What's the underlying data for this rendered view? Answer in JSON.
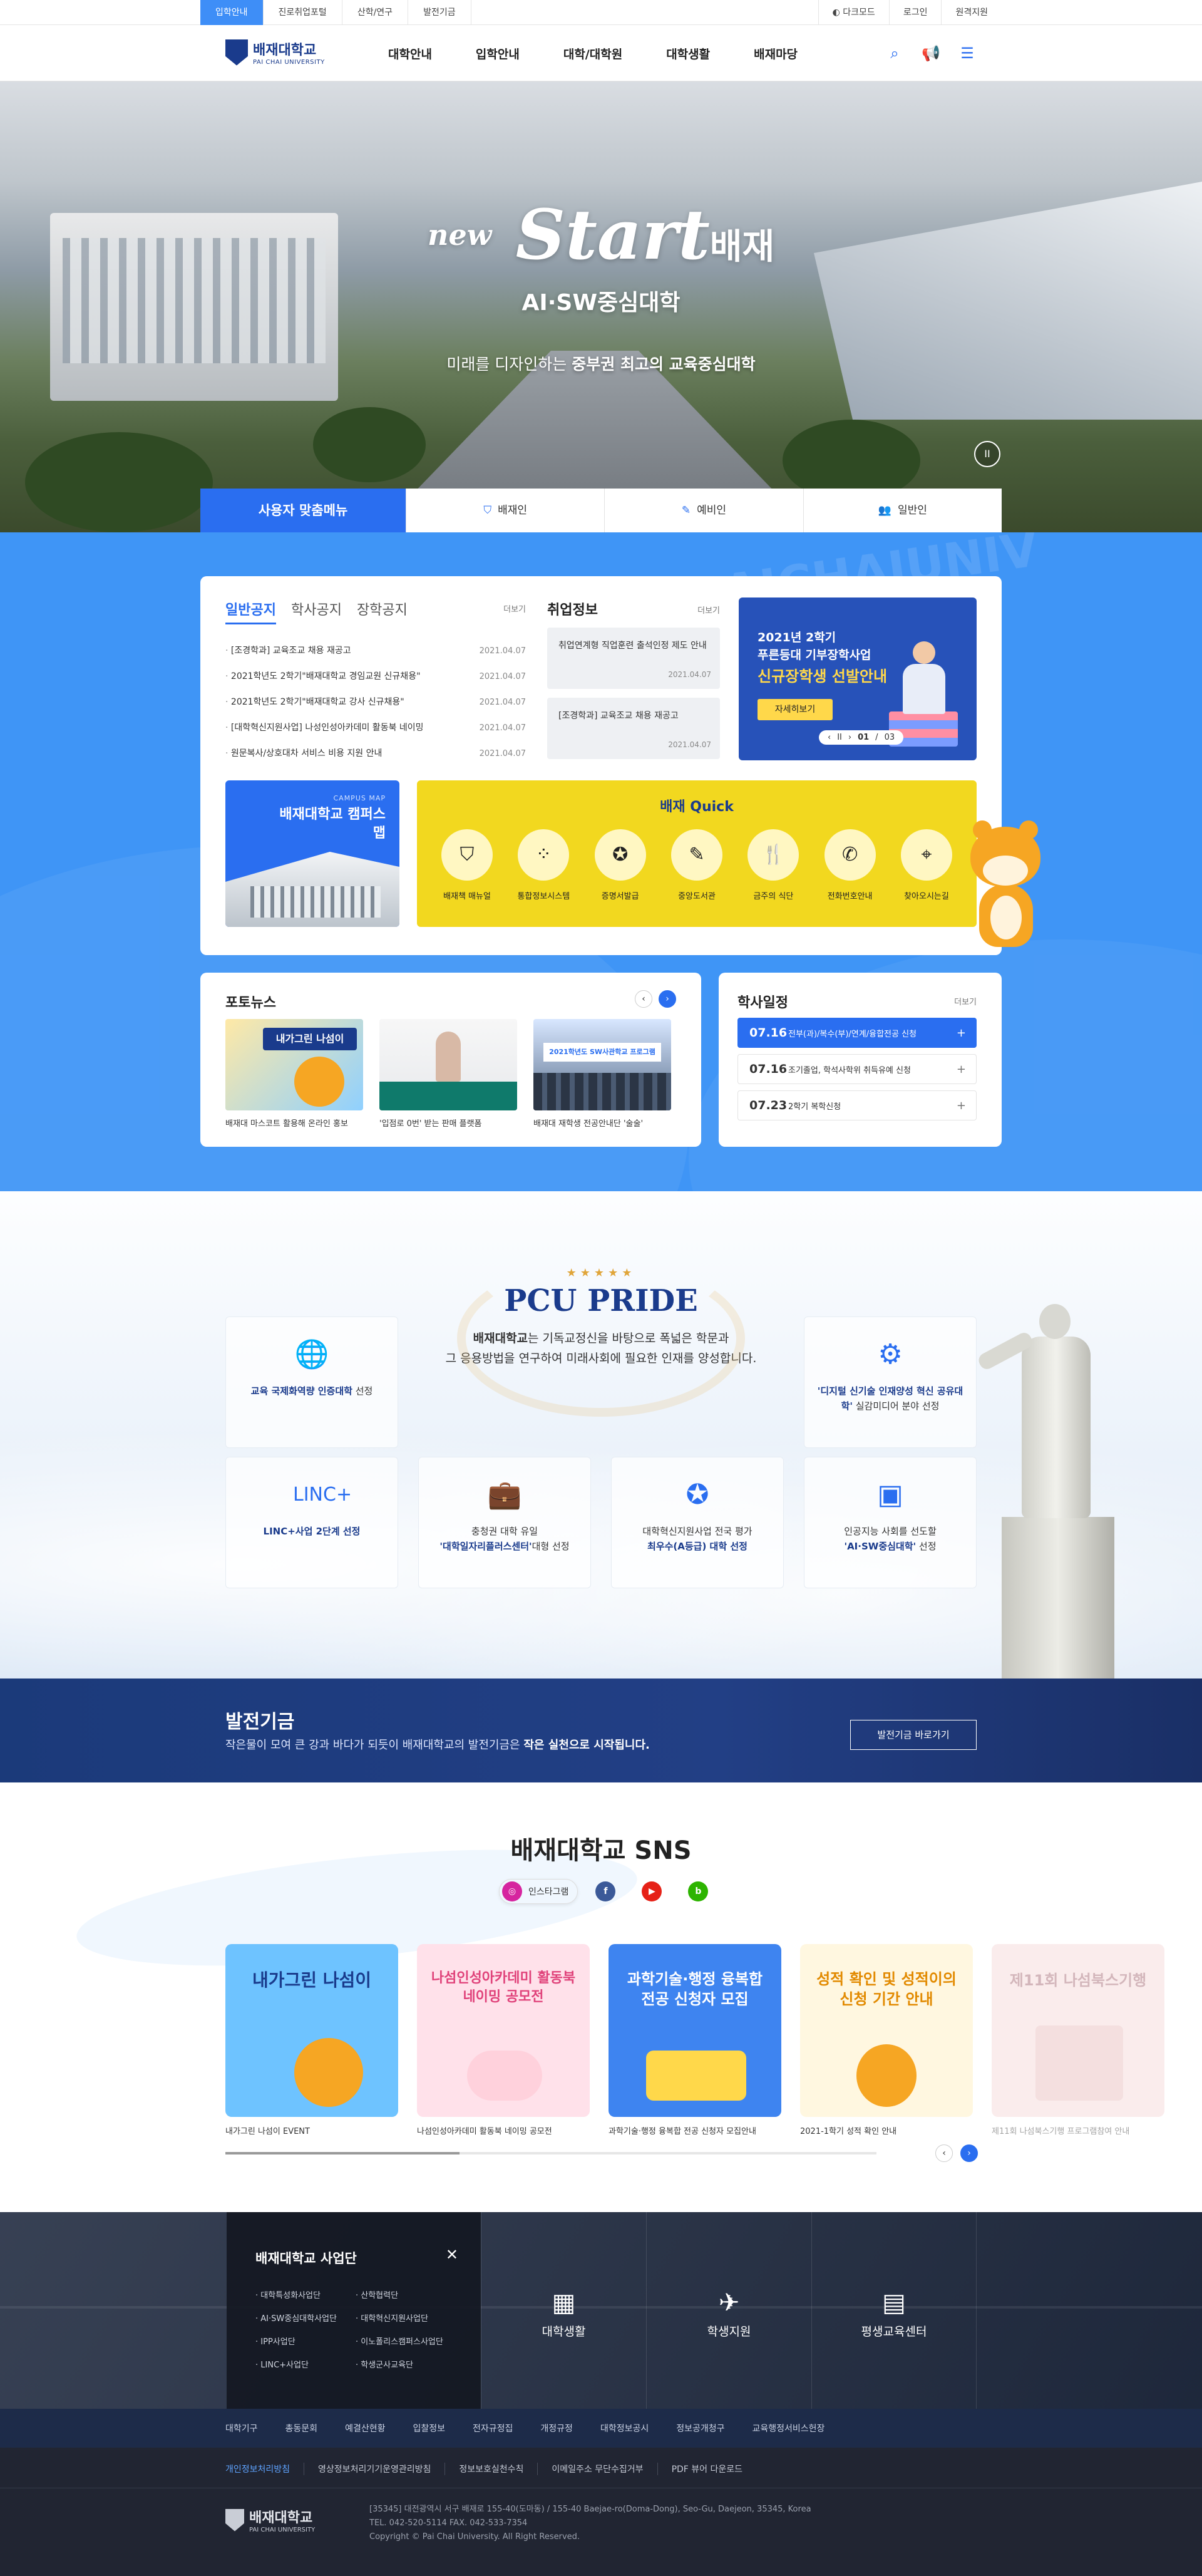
{
  "utility": {
    "left": [
      "입학안내",
      "진로취업포털",
      "산학/연구",
      "발전기금"
    ],
    "right": [
      "다크모드",
      "로그인",
      "원격지원"
    ]
  },
  "header": {
    "logo_kr": "배재대학교",
    "logo_en": "PAI CHAI UNIVERSITY",
    "nav": [
      "대학안내",
      "입학안내",
      "대학/대학원",
      "대학생활",
      "배재마당"
    ]
  },
  "hero": {
    "title": "Start",
    "title_suffix": "배재",
    "title_prefix": "new",
    "sub": "AI·SW중심대학",
    "tagline_pre": "미래를 디자인하는 ",
    "tagline_bold": "중부권 최고의 교육중심대학",
    "pause": "II"
  },
  "custom_menu": {
    "lead": "사용자 맞춤메뉴",
    "tabs": [
      "배재인",
      "예비인",
      "일반인"
    ]
  },
  "watermark": "PAICHAIUNIV",
  "notice": {
    "tabs": [
      "일반공지",
      "학사공지",
      "장학공지"
    ],
    "more": "더보기",
    "items": [
      {
        "title": "[조경학과] 교육조교 채용 재공고",
        "date": "2021.04.07"
      },
      {
        "title": "2021학년도 2학기\"배재대학교 경임교원 신규채용\"",
        "date": "2021.04.07"
      },
      {
        "title": "2021학년도 2학기\"배재대학교 강사 신규채용\"",
        "date": "2021.04.07"
      },
      {
        "title": "[대학혁신지원사업] 나성인성아카데미 활동북 네이밍",
        "date": "2021.04.07"
      },
      {
        "title": "원문복사/상호대차 서비스 비용 지원 안내",
        "date": "2021.04.07"
      }
    ]
  },
  "jobs": {
    "title": "취업정보",
    "more": "더보기",
    "items": [
      {
        "title": "취업연계형 직업훈련 출석인정 제도 안내",
        "date": "2021.04.07"
      },
      {
        "title": "[조경학과] 교육조교 채용 재공고",
        "date": "2021.04.07"
      }
    ]
  },
  "banner": {
    "line1": "2021년 2학기",
    "line2": "푸른등대 기부장학사업",
    "line3": "신규장학생 선발안내",
    "button": "자세히보기",
    "pager_current": "01",
    "pager_total": "03"
  },
  "campus_map": {
    "small": "CAMPUS MAP",
    "title": "배재대학교 캠퍼스맵"
  },
  "quick": {
    "title": "배재 Quick",
    "items": [
      {
        "label": "배재책 매뉴얼",
        "icon": "shield-icon"
      },
      {
        "label": "통합정보시스템",
        "icon": "grid-icon"
      },
      {
        "label": "증명서발급",
        "icon": "medal-icon"
      },
      {
        "label": "중앙도서관",
        "icon": "edit-icon"
      },
      {
        "label": "금주의 식단",
        "icon": "utensils-icon"
      },
      {
        "label": "전화번호안내",
        "icon": "phone-icon"
      },
      {
        "label": "찾아오시는길",
        "icon": "map-pin-icon"
      }
    ]
  },
  "photo_news": {
    "title": "포토뉴스",
    "items": [
      {
        "caption": "배재대 마스코트 활용해 온라인 홍보",
        "img_text": "내가그린 나섬이"
      },
      {
        "caption": "'입점로 0번' 받는 판매 플랫폼",
        "img_text": ""
      },
      {
        "caption": "배재대 재학생 전공안내단 '술술'",
        "img_text": "2021학년도 SW사관학교 프로그램"
      }
    ]
  },
  "schedule": {
    "title": "학사일정",
    "more": "더보기",
    "items": [
      {
        "date": "07.16",
        "text": "전부(과)/복수(부)/연계/융합전공 신청"
      },
      {
        "date": "07.16",
        "text": "조기졸업, 학석사학위 취득유예 신청"
      },
      {
        "date": "07.23",
        "text": "2학기 복학신청"
      }
    ]
  },
  "pride": {
    "stars": "★★★★★",
    "title": "PCU PRIDE",
    "desc_bold": "배재대학교",
    "desc_rest": "는 기독교정신을 바탕으로 폭넓은 학문과",
    "desc2": "그 응용방법을 연구하여 미래사회에 필요한 인재를 양성합니다.",
    "boxes": [
      {
        "icon": "globe-icon",
        "bold": "교육 국제화역량 인증대학",
        "rest": "선정"
      },
      {
        "icon": "brain-icon",
        "bold": "'디지털 신기술 인재양성 혁신 공유대학'",
        "rest": "실감미디어 분야 선정"
      },
      {
        "icon": "linc-icon",
        "bold": "LINC+사업 2단계 선정",
        "rest": ""
      },
      {
        "icon": "briefcase-icon",
        "pre": "충청권 대학 유일",
        "bold": "'대학일자리플러스센터'",
        "rest": "대형 선정"
      },
      {
        "icon": "badge-icon",
        "pre": "대학혁신지원사업 전국 평가",
        "bold": "최우수(A등급) 대학 선정",
        "rest": ""
      },
      {
        "icon": "chip-icon",
        "pre": "인공지능 사회를 선도할",
        "bold": "'AI·SW중심대학'",
        "rest": "선정"
      }
    ],
    "linc_text": "LINC+"
  },
  "fund": {
    "title": "발전기금",
    "desc_pre": "작은물이 모여 큰 강과 바다가 되듯이 배재대학교의 발전기금은 ",
    "desc_bold": "작은 실천으로 시작됩니다.",
    "button": "발전기금 바로가기"
  },
  "sns": {
    "title": "배재대학교 SNS",
    "tabs": [
      {
        "label": "인스타그램",
        "icon": "instagram-icon",
        "glyph": "◎",
        "color": "#d6249f"
      },
      {
        "label": "",
        "icon": "facebook-icon",
        "glyph": "f",
        "color": "#3b5998"
      },
      {
        "label": "",
        "icon": "youtube-icon",
        "glyph": "▶",
        "color": "#e62117"
      },
      {
        "label": "",
        "icon": "blog-icon",
        "glyph": "b",
        "color": "#2db400"
      }
    ],
    "items": [
      {
        "caption": "내가그린 나섬이 EVENT",
        "head": "내가그린 나섬이",
        "bg": "#6ec3ff",
        "fg": "#1a3b8c"
      },
      {
        "caption": "나섬인성아카데미 활동북 네이밍 공모전",
        "head": "나섬인성아카데미 활동북 네이밍 공모전",
        "bg": "#ffe1ea",
        "fg": "#e0427a"
      },
      {
        "caption": "과학기술·행정 융복합 전공 신청자 모집안내",
        "head": "과학기술·행정 융복합 전공 신청자 모집",
        "bg": "#3e84f0",
        "fg": "#ffffff"
      },
      {
        "caption": "2021-1학기 성적 확인 안내",
        "head": "성적 확인 및 성적이의 신청 기간 안내",
        "bg": "#fff7e0",
        "fg": "#e28a00"
      },
      {
        "caption": "제11회 나섬북스기행 프로그램참여 안내",
        "head": "제11회 나섬북스기행",
        "bg": "#f4d6d6",
        "fg": "#a0606a"
      }
    ]
  },
  "footer_group": {
    "panel_title": "배재대학교 사업단",
    "panel_items": [
      "대학특성화사업단",
      "산학협력단",
      "AI·SW중심대학사업단",
      "대학혁신지원사업단",
      "IPP사업단",
      "이노폴리스캠퍼스사업단",
      "LINC+사업단",
      "학생군사교육단"
    ],
    "cols": [
      {
        "label": "대학생활",
        "icon": "building-icon",
        "glyph": "▦"
      },
      {
        "label": "학생지원",
        "icon": "paper-plane-icon",
        "glyph": "✈"
      },
      {
        "label": "평생교육센터",
        "icon": "document-icon",
        "glyph": "▤"
      }
    ]
  },
  "footer_nav": [
    "대학기구",
    "총동문회",
    "예결산현황",
    "입찰정보",
    "전자규정집",
    "개정규정",
    "대학정보공시",
    "정보공개청구",
    "교육행정서비스헌장"
  ],
  "footer": {
    "links": [
      "개인정보처리방침",
      "영상정보처리기기운영관리방침",
      "정보보호실천수칙",
      "이메일주소 무단수집거부",
      "PDF 뷰어 다운로드"
    ],
    "logo_kr": "배재대학교",
    "logo_en": "PAI CHAI UNIVERSITY",
    "addr": "[35345] 대전광역시 서구 배재로 155-40(도마동) / 155-40 Baejae-ro(Doma-Dong), Seo-Gu, Daejeon, 35345, Korea",
    "tel": "TEL. 042-520-5114 FAX. 042-533-7354",
    "copy": "Copyright © Pai Chai University. All Right Reserved."
  }
}
